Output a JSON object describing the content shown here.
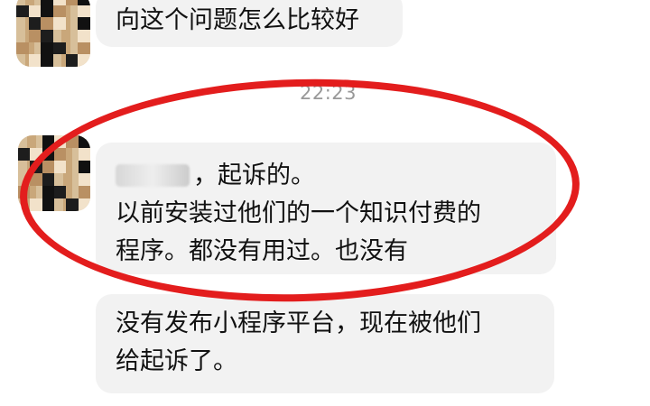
{
  "chat": {
    "top_message": "向这个问题怎么比较好",
    "timestamp": "22:23",
    "highlighted_message": {
      "line1_suffix": "，起诉的。",
      "line2": "以前安装过他们的一个知识付费的",
      "line3": "程序。都没有用过。也没有"
    },
    "bottom_message": {
      "line1": "没有发布小程序平台，现在被他们",
      "line2": "给起诉了。"
    }
  }
}
